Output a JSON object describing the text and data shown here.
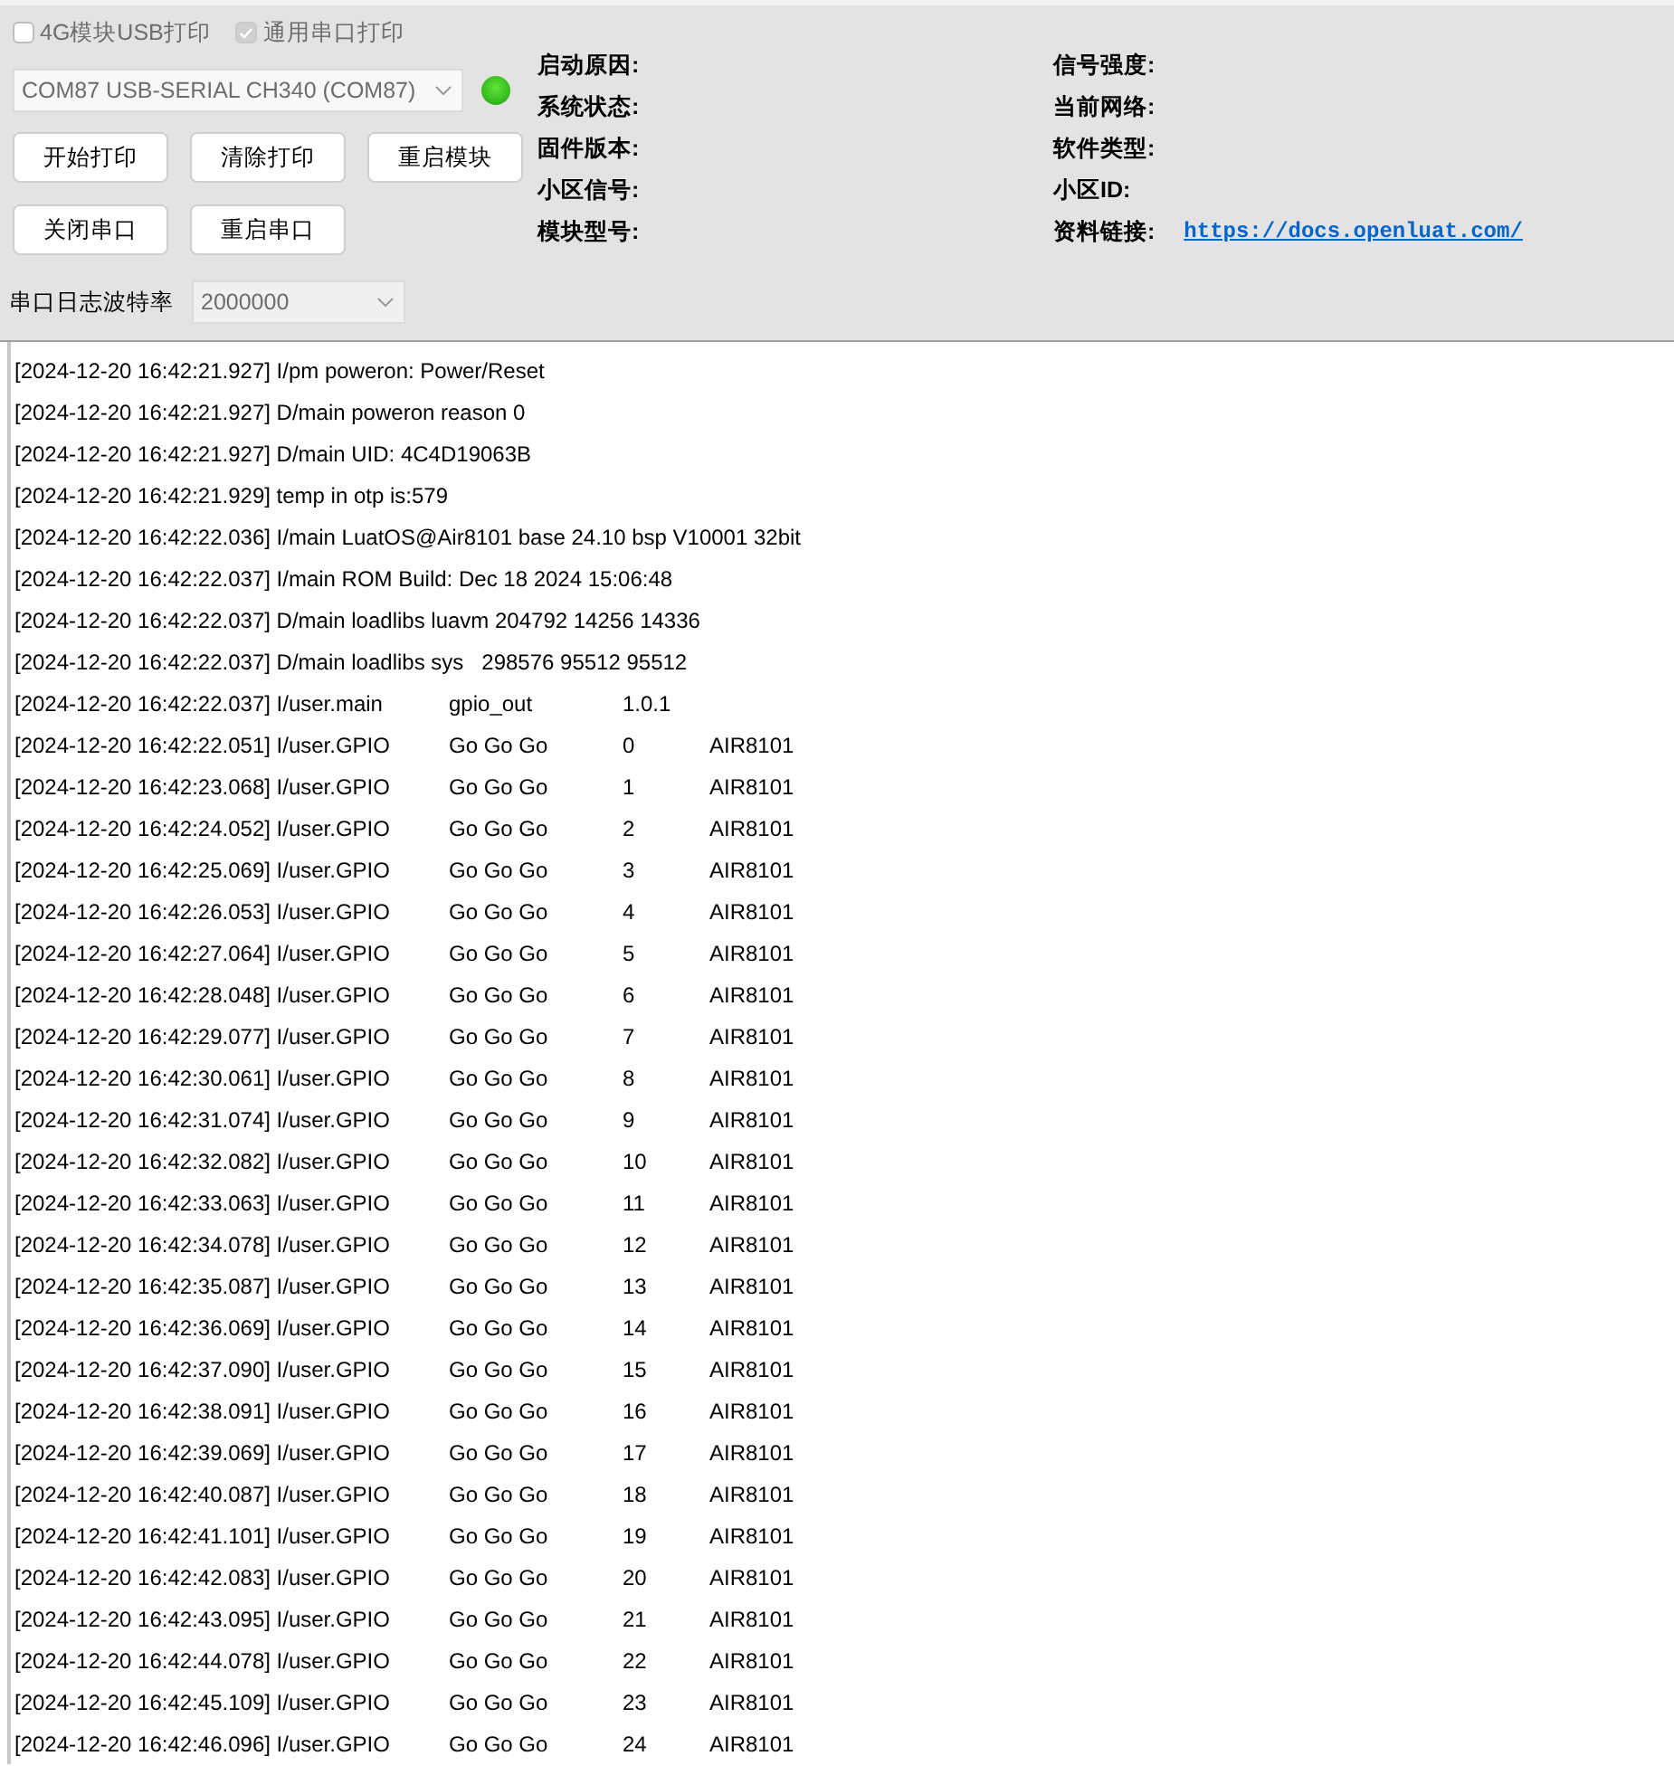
{
  "options": [
    {
      "label": "4G模块USB打印",
      "checked": false,
      "disabled": false
    },
    {
      "label": "通用串口打印",
      "checked": true,
      "disabled": true
    }
  ],
  "port": {
    "value": "COM87 USB-SERIAL CH340 (COM87)",
    "connected": true
  },
  "buttons": [
    [
      "开始打印",
      "清除打印",
      "重启模块"
    ],
    [
      "关闭串口",
      "重启串口"
    ]
  ],
  "baud": {
    "label": "串口日志波特率",
    "value": "2000000"
  },
  "info_left": [
    "启动原因:",
    "系统状态:",
    "固件版本:",
    "小区信号:",
    "模块型号:"
  ],
  "info_right": [
    {
      "label": "信号强度:"
    },
    {
      "label": "当前网络:"
    },
    {
      "label": "软件类型:"
    },
    {
      "label": "小区ID:"
    },
    {
      "label": "资料链接:",
      "link": "https://docs.openluat.com/"
    }
  ],
  "log": [
    {
      "kind": "plain",
      "text": "[2024-12-20 16:42:21.927] I/pm poweron: Power/Reset"
    },
    {
      "kind": "plain",
      "text": "[2024-12-20 16:42:21.927] D/main poweron reason 0"
    },
    {
      "kind": "plain",
      "text": "[2024-12-20 16:42:21.927] D/main UID: 4C4D19063B"
    },
    {
      "kind": "plain",
      "text": "[2024-12-20 16:42:21.929] temp in otp is:579"
    },
    {
      "kind": "plain",
      "text": "[2024-12-20 16:42:22.036] I/main LuatOS@Air8101 base 24.10 bsp V10001 32bit"
    },
    {
      "kind": "plain",
      "text": "[2024-12-20 16:42:22.037] I/main ROM Build: Dec 18 2024 15:06:48"
    },
    {
      "kind": "plain",
      "text": "[2024-12-20 16:42:22.037] D/main loadlibs luavm 204792 14256 14336"
    },
    {
      "kind": "plain",
      "text": "[2024-12-20 16:42:22.037] D/main loadlibs sys   298576 95512 95512"
    },
    {
      "kind": "cols",
      "cells": [
        "[2024-12-20 16:42:22.037] I/user.main",
        "gpio_out",
        "1.0.1"
      ]
    },
    {
      "kind": "cols",
      "cells": [
        "[2024-12-20 16:42:22.051] I/user.GPIO",
        "Go Go Go",
        "0",
        "AIR8101"
      ]
    },
    {
      "kind": "cols",
      "cells": [
        "[2024-12-20 16:42:23.068] I/user.GPIO",
        "Go Go Go",
        "1",
        "AIR8101"
      ]
    },
    {
      "kind": "cols",
      "cells": [
        "[2024-12-20 16:42:24.052] I/user.GPIO",
        "Go Go Go",
        "2",
        "AIR8101"
      ]
    },
    {
      "kind": "cols",
      "cells": [
        "[2024-12-20 16:42:25.069] I/user.GPIO",
        "Go Go Go",
        "3",
        "AIR8101"
      ]
    },
    {
      "kind": "cols",
      "cells": [
        "[2024-12-20 16:42:26.053] I/user.GPIO",
        "Go Go Go",
        "4",
        "AIR8101"
      ]
    },
    {
      "kind": "cols",
      "cells": [
        "[2024-12-20 16:42:27.064] I/user.GPIO",
        "Go Go Go",
        "5",
        "AIR8101"
      ]
    },
    {
      "kind": "cols",
      "cells": [
        "[2024-12-20 16:42:28.048] I/user.GPIO",
        "Go Go Go",
        "6",
        "AIR8101"
      ]
    },
    {
      "kind": "cols",
      "cells": [
        "[2024-12-20 16:42:29.077] I/user.GPIO",
        "Go Go Go",
        "7",
        "AIR8101"
      ]
    },
    {
      "kind": "cols",
      "cells": [
        "[2024-12-20 16:42:30.061] I/user.GPIO",
        "Go Go Go",
        "8",
        "AIR8101"
      ]
    },
    {
      "kind": "cols",
      "cells": [
        "[2024-12-20 16:42:31.074] I/user.GPIO",
        "Go Go Go",
        "9",
        "AIR8101"
      ]
    },
    {
      "kind": "cols",
      "cells": [
        "[2024-12-20 16:42:32.082] I/user.GPIO",
        "Go Go Go",
        "10",
        "AIR8101"
      ]
    },
    {
      "kind": "cols",
      "cells": [
        "[2024-12-20 16:42:33.063] I/user.GPIO",
        "Go Go Go",
        "11",
        "AIR8101"
      ]
    },
    {
      "kind": "cols",
      "cells": [
        "[2024-12-20 16:42:34.078] I/user.GPIO",
        "Go Go Go",
        "12",
        "AIR8101"
      ]
    },
    {
      "kind": "cols",
      "cells": [
        "[2024-12-20 16:42:35.087] I/user.GPIO",
        "Go Go Go",
        "13",
        "AIR8101"
      ]
    },
    {
      "kind": "cols",
      "cells": [
        "[2024-12-20 16:42:36.069] I/user.GPIO",
        "Go Go Go",
        "14",
        "AIR8101"
      ]
    },
    {
      "kind": "cols",
      "cells": [
        "[2024-12-20 16:42:37.090] I/user.GPIO",
        "Go Go Go",
        "15",
        "AIR8101"
      ]
    },
    {
      "kind": "cols",
      "cells": [
        "[2024-12-20 16:42:38.091] I/user.GPIO",
        "Go Go Go",
        "16",
        "AIR8101"
      ]
    },
    {
      "kind": "cols",
      "cells": [
        "[2024-12-20 16:42:39.069] I/user.GPIO",
        "Go Go Go",
        "17",
        "AIR8101"
      ]
    },
    {
      "kind": "cols",
      "cells": [
        "[2024-12-20 16:42:40.087] I/user.GPIO",
        "Go Go Go",
        "18",
        "AIR8101"
      ]
    },
    {
      "kind": "cols",
      "cells": [
        "[2024-12-20 16:42:41.101] I/user.GPIO",
        "Go Go Go",
        "19",
        "AIR8101"
      ]
    },
    {
      "kind": "cols",
      "cells": [
        "[2024-12-20 16:42:42.083] I/user.GPIO",
        "Go Go Go",
        "20",
        "AIR8101"
      ]
    },
    {
      "kind": "cols",
      "cells": [
        "[2024-12-20 16:42:43.095] I/user.GPIO",
        "Go Go Go",
        "21",
        "AIR8101"
      ]
    },
    {
      "kind": "cols",
      "cells": [
        "[2024-12-20 16:42:44.078] I/user.GPIO",
        "Go Go Go",
        "22",
        "AIR8101"
      ]
    },
    {
      "kind": "cols",
      "cells": [
        "[2024-12-20 16:42:45.109] I/user.GPIO",
        "Go Go Go",
        "23",
        "AIR8101"
      ]
    },
    {
      "kind": "cols",
      "cells": [
        "[2024-12-20 16:42:46.096] I/user.GPIO",
        "Go Go Go",
        "24",
        "AIR8101"
      ]
    }
  ]
}
